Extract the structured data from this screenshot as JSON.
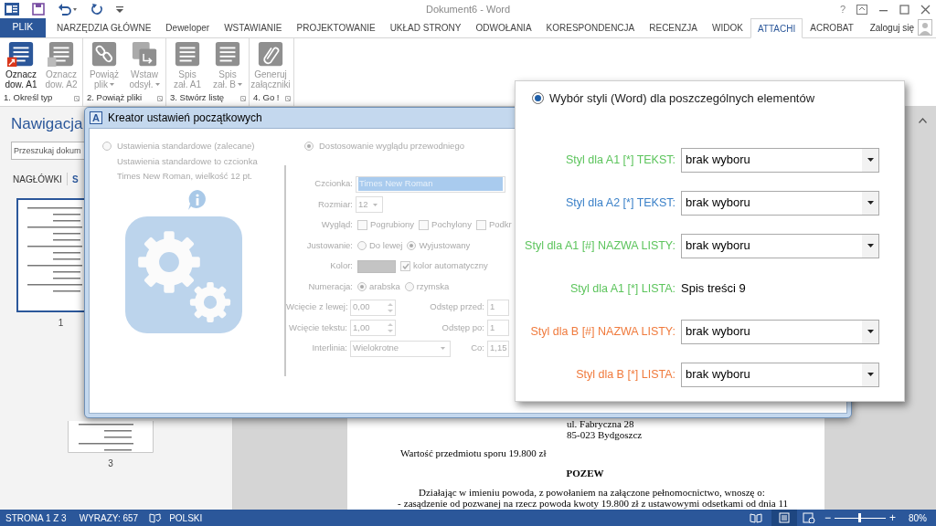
{
  "window": {
    "title": "Dokument6 - Word",
    "help": "?"
  },
  "ribbon_tabs": [
    {
      "label": "PLIK",
      "kind": "file",
      "selected": false
    },
    {
      "label": "NARZĘDZIA GŁÓWNE",
      "kind": "tab",
      "selected": false
    },
    {
      "label": "Deweloper",
      "kind": "tab",
      "selected": false
    },
    {
      "label": "WSTAWIANIE",
      "kind": "tab",
      "selected": false
    },
    {
      "label": "PROJEKTOWANIE",
      "kind": "tab",
      "selected": false
    },
    {
      "label": "UKŁAD STRONY",
      "kind": "tab",
      "selected": false
    },
    {
      "label": "ODWOŁANIA",
      "kind": "tab",
      "selected": false
    },
    {
      "label": "KORESPONDENCJA",
      "kind": "tab",
      "selected": false
    },
    {
      "label": "RECENZJA",
      "kind": "tab",
      "selected": false
    },
    {
      "label": "WIDOK",
      "kind": "tab",
      "selected": false
    },
    {
      "label": "ATTACHI",
      "kind": "tab",
      "selected": true
    },
    {
      "label": "ACROBAT",
      "kind": "tab",
      "selected": false
    }
  ],
  "account": "Zaloguj się",
  "ribbon_groups": [
    {
      "label": "1. Określ typ",
      "buttons": [
        {
          "kind": "mark",
          "lines": [
            "Oznacz",
            "dow. A1"
          ],
          "disabled": false,
          "dropdown": false
        },
        {
          "kind": "mark",
          "lines": [
            "Oznacz",
            "dow. A2"
          ],
          "disabled": true,
          "dropdown": false
        }
      ]
    },
    {
      "label": "2. Powiąż pliki",
      "buttons": [
        {
          "kind": "link",
          "lines": [
            "Powiąż",
            "plik"
          ],
          "disabled": true,
          "dropdown": true
        },
        {
          "kind": "insert",
          "lines": [
            "Wstaw",
            "odsył."
          ],
          "disabled": true,
          "dropdown": true
        }
      ]
    },
    {
      "label": "3. Stwórz listę",
      "buttons": [
        {
          "kind": "list",
          "lines": [
            "Spis",
            "zał. A1"
          ],
          "disabled": true,
          "dropdown": false
        },
        {
          "kind": "list",
          "lines": [
            "Spis",
            "zał. B"
          ],
          "disabled": true,
          "dropdown": true
        }
      ]
    },
    {
      "label": "4. Go !",
      "buttons": [
        {
          "kind": "clip",
          "lines": [
            "Generuj",
            "załączniki"
          ],
          "disabled": true,
          "dropdown": false
        }
      ]
    }
  ],
  "navigation": {
    "title": "Nawigacja",
    "search": {
      "placeholder": "Przeszukaj dokum"
    },
    "tabs": [
      {
        "label": "NAGŁÓWKI",
        "selected": false
      },
      {
        "label": "S",
        "selected": true
      }
    ],
    "pages": [
      {
        "label": "1",
        "selected": true
      },
      {
        "label": "3",
        "selected": false
      }
    ]
  },
  "document": {
    "lines": [
      {
        "kind": "center",
        "text": "ul. Fabryczna 28"
      },
      {
        "kind": "center",
        "text": "85-023 Bydgoszcz"
      },
      {
        "kind": "plain",
        "text": "Wartość przedmiotu sporu 19.800 zł"
      },
      {
        "kind": "heading",
        "text": "POZEW"
      },
      {
        "kind": "indent",
        "text": "Działając w imieniu powoda, z powołaniem na załączone pełnomocnictwo, wnoszę o:"
      },
      {
        "kind": "bullet",
        "bullet": "-",
        "text": "zasądzenie od pozwanej na rzecz powoda kwoty 19.800 zł z ustawowymi odsetkami od dnia 11"
      }
    ]
  },
  "dialog": {
    "title": "Kreator ustawień początkowych",
    "icon_letter": "A",
    "disabled": true,
    "standard": {
      "label": "Ustawienia standardowe (zalecane)",
      "selected": false,
      "description": [
        "Ustawienia standardowe to czcionka",
        "Times New Roman, wielkość 12 pt."
      ]
    },
    "custom": {
      "label": "Dostosowanie wyglądu przewodniego",
      "selected": true
    },
    "rows": [
      {
        "kind": "text",
        "label": "Czcionka:",
        "value": "Times New Roman"
      },
      {
        "kind": "combo",
        "label": "Rozmiar:",
        "value": "12"
      },
      {
        "kind": "checks",
        "label": "Wygląd:",
        "options": [
          {
            "label": "Pogrubiony",
            "checked": false
          },
          {
            "label": "Pochylony",
            "checked": false
          },
          {
            "label": "Podkr",
            "checked": false
          }
        ]
      },
      {
        "kind": "radios",
        "label": "Justowanie:",
        "options": [
          {
            "label": "Do lewej",
            "selected": false
          },
          {
            "label": "Wyjustowany",
            "selected": true
          }
        ]
      },
      {
        "kind": "color",
        "label": "Kolor:",
        "options": [
          {
            "label": "kolor automatyczny",
            "checked": true
          }
        ]
      },
      {
        "kind": "radios",
        "label": "Numeracja:",
        "options": [
          {
            "label": "arabska",
            "selected": true
          },
          {
            "label": "rzymska",
            "selected": false
          }
        ]
      },
      {
        "kind": "spin",
        "label": "Wcięcie z lewej:",
        "value": "0,00",
        "label2": "Odstęp przed:",
        "value2": "1"
      },
      {
        "kind": "spin",
        "label": "Wcięcie tekstu:",
        "value": "1,00",
        "label2": "Odstęp po:",
        "value2": "1"
      },
      {
        "kind": "combopair",
        "label": "Interlinia:",
        "value": "Wielokrotne",
        "label2": "Co:",
        "value2": "1,15"
      }
    ]
  },
  "styles_panel": {
    "option": {
      "label": "Wybór styli (Word) dla poszczególnych elementów",
      "selected": true
    },
    "rows": [
      {
        "kind": "dropdown",
        "label": "Styl dla A1 [*] TEKST:",
        "color": "#5cc45c",
        "value": "brak wyboru"
      },
      {
        "kind": "dropdown",
        "label": "Styl dla A2 [*] TEKST:",
        "color": "#3a80c8",
        "value": "brak wyboru"
      },
      {
        "kind": "dropdown",
        "label": "Styl dla A1 [#] NAZWA LISTY:",
        "color": "#5cc45c",
        "value": "brak wyboru"
      },
      {
        "kind": "text",
        "label": "Styl dla A1 [*] LISTA:",
        "color": "#5cc45c",
        "value": "Spis treści 9"
      },
      {
        "kind": "dropdown",
        "label": "Styl dla B [#] NAZWA LISTY:",
        "color": "#f07a3c",
        "value": "brak wyboru"
      },
      {
        "kind": "dropdown",
        "label": "Styl dla B [*] LISTA:",
        "color": "#f07a3c",
        "value": "brak wyboru"
      }
    ]
  },
  "status_bar": {
    "page": "STRONA 1 Z 3",
    "words": "WYRAZY: 657",
    "language": "POLSKI",
    "zoom_out": "−",
    "zoom_in": "+",
    "zoom": "80%",
    "zoom_slider": {
      "level": 0.5
    }
  }
}
